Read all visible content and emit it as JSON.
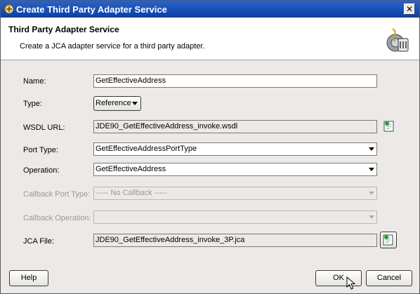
{
  "window": {
    "title": "Create Third Party Adapter Service",
    "close_glyph": "✕"
  },
  "header": {
    "title": "Third Party Adapter Service",
    "description": "Create a JCA adapter service for a third party adapter."
  },
  "form": {
    "name": {
      "label": "Name:",
      "value": "GetEffectiveAddress"
    },
    "type": {
      "label": "Type:",
      "value": "Reference"
    },
    "wsdl_url": {
      "label": "WSDL URL:",
      "value": "JDE90_GetEffectiveAddress_invoke.wsdl"
    },
    "port_type": {
      "label": "Port Type:",
      "value": "GetEffectiveAddressPortType"
    },
    "operation": {
      "label": "Operation:",
      "value": "GetEffectiveAddress"
    },
    "callback_port_type": {
      "label": "Callback Port Type:",
      "value": "----- No Callback -----"
    },
    "callback_operation": {
      "label": "Callback Operation:",
      "value": ""
    },
    "jca_file": {
      "label": "JCA File:",
      "value": "JDE90_GetEffectiveAddress_invoke_3P.jca"
    }
  },
  "buttons": {
    "help": "Help",
    "ok": "OK",
    "cancel": "Cancel"
  },
  "icons": {
    "app": "adapter-icon",
    "wizard": "wizard-header-icon",
    "browse": "browse-icon",
    "cursor": "mouse-cursor-icon"
  }
}
